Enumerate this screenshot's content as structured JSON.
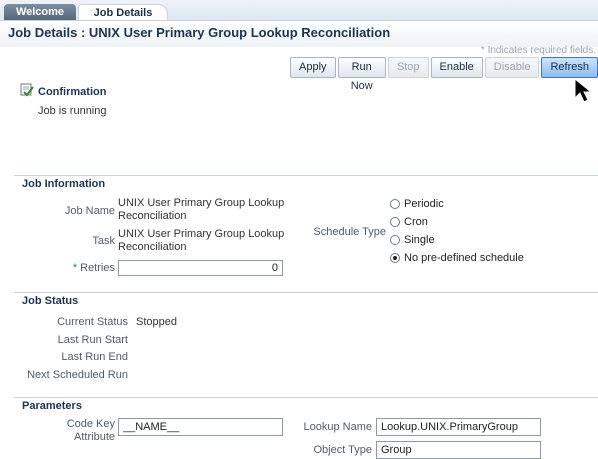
{
  "tabs": [
    {
      "label": "Welcome"
    },
    {
      "label": "Job Details"
    }
  ],
  "page_title": "Job Details : UNIX User Primary Group Lookup Reconciliation",
  "required_note": "* Indicates required fields.",
  "toolbar": {
    "apply": "Apply",
    "run_now": "Run Now",
    "stop": "Stop",
    "enable": "Enable",
    "disable": "Disable",
    "refresh": "Refresh"
  },
  "confirmation": {
    "title": "Confirmation",
    "message": "Job is running"
  },
  "job_information": {
    "heading": "Job Information",
    "job_name_label": "Job Name",
    "job_name_value": "UNIX User Primary Group Lookup Reconciliation",
    "task_label": "Task",
    "task_value": "UNIX User Primary Group Lookup Reconciliation",
    "retries_required": "*",
    "retries_label": "Retries",
    "retries_value": "0",
    "schedule_type_label": "Schedule Type",
    "schedule_options": [
      {
        "label": "Periodic",
        "selected": false
      },
      {
        "label": "Cron",
        "selected": false
      },
      {
        "label": "Single",
        "selected": false
      },
      {
        "label": "No pre-defined schedule",
        "selected": true
      }
    ]
  },
  "job_status": {
    "heading": "Job Status",
    "current_status_label": "Current Status",
    "current_status_value": "Stopped",
    "last_run_start_label": "Last Run Start",
    "last_run_end_label": "Last Run End",
    "next_scheduled_run_label": "Next Scheduled Run"
  },
  "parameters": {
    "heading": "Parameters",
    "code_key_label_line1": "Code Key",
    "code_key_label_line2": "Attribute",
    "code_key_value": "__NAME__",
    "lookup_name_label": "Lookup Name",
    "lookup_name_value": "Lookup.UNIX.PrimaryGroup",
    "object_type_label": "Object Type",
    "object_type_value": "Group"
  }
}
